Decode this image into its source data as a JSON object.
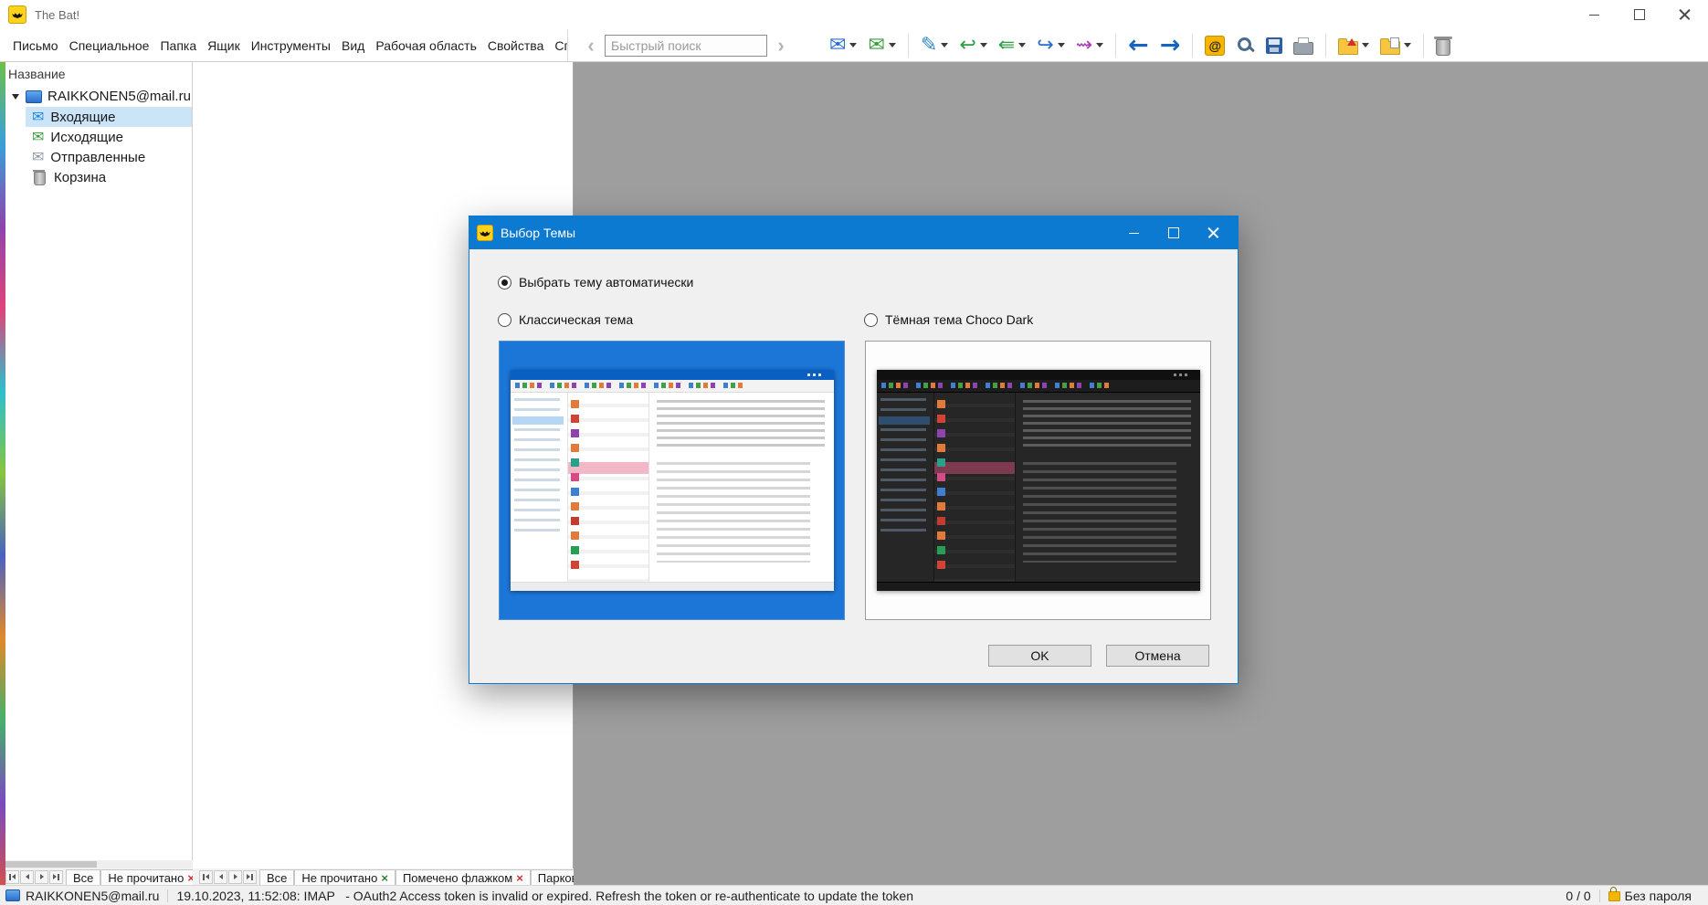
{
  "window": {
    "title": "The Bat!"
  },
  "menubar": {
    "items": [
      "Письмо",
      "Специальное",
      "Папка",
      "Ящик",
      "Инструменты",
      "Вид",
      "Рабочая область",
      "Свойства",
      "Справка"
    ]
  },
  "search": {
    "placeholder": "Быстрый поиск"
  },
  "toolbar": {
    "buttons": [
      {
        "name": "new-message",
        "glyph": "✉",
        "color": "#2a6fce",
        "dropdown": true
      },
      {
        "name": "new-message-from-template",
        "glyph": "✉",
        "color": "#3a9e3a",
        "dropdown": true
      },
      {
        "name": "edit-templates",
        "glyph": "✎",
        "color": "#2e86c1",
        "dropdown": true,
        "group_start": true
      },
      {
        "name": "reply",
        "glyph": "↩",
        "color": "#2f9e44",
        "dropdown": true
      },
      {
        "name": "reply-all",
        "glyph": "⇚",
        "color": "#2f9e44",
        "dropdown": true
      },
      {
        "name": "forward",
        "glyph": "↪",
        "color": "#2a6fce",
        "dropdown": true
      },
      {
        "name": "redirect",
        "glyph": "⇝",
        "color": "#a93db8",
        "dropdown": true
      },
      {
        "name": "previous-unread",
        "glyph": "←",
        "color": "#1565c0",
        "group_start": true
      },
      {
        "name": "next-unread",
        "glyph": "→",
        "color": "#1565c0"
      },
      {
        "name": "address-book",
        "glyph": "@",
        "css": "addressbook",
        "group_start": true
      },
      {
        "name": "search-messages",
        "css": "search"
      },
      {
        "name": "save-message",
        "css": "save"
      },
      {
        "name": "print-message",
        "css": "print"
      },
      {
        "name": "move-to-folder",
        "css": "folder folder-move",
        "dropdown": true,
        "group_start": true
      },
      {
        "name": "copy-to-folder",
        "css": "folder folder-copy",
        "dropdown": true
      },
      {
        "name": "delete-message",
        "css": "trashcan",
        "group_start": true
      }
    ]
  },
  "sidebar": {
    "header": "Название",
    "account": "RAIKKONEN5@mail.ru",
    "folders": [
      {
        "name": "inbox",
        "label": "Входящие",
        "glyph": "✉",
        "color": "#1e88e5",
        "selected": true
      },
      {
        "name": "outbox",
        "label": "Исходящие",
        "glyph": "✉",
        "color": "#3a9e3a"
      },
      {
        "name": "sent",
        "label": "Отправленные",
        "glyph": "✉",
        "color": "#8d9aa5"
      },
      {
        "name": "trash",
        "label": "Корзина",
        "css": "trash"
      }
    ]
  },
  "folder_tabs": {
    "close_glyph": "×",
    "groups": [
      {
        "tabs": [
          {
            "label": "Все"
          },
          {
            "label": "Не прочитано",
            "close_color": "#d32f2f"
          }
        ]
      },
      {
        "tabs": [
          {
            "label": "Все"
          },
          {
            "label": "Не прочитано",
            "close_color": "#2e7d32"
          },
          {
            "label": "Помечено флажком",
            "close_color": "#d32f2f"
          },
          {
            "label": "Парков"
          }
        ]
      }
    ]
  },
  "statusbar": {
    "account": "RAIKKONEN5@mail.ru",
    "message": "19.10.2023, 11:52:08: IMAP   - OAuth2 Access token is invalid or expired. Refresh the token or re-authenticate to update the token",
    "counter": "0 / 0",
    "password_mode": "Без пароля"
  },
  "dialog": {
    "title": "Выбор Темы",
    "options": {
      "auto": "Выбрать тему автоматически",
      "classic": "Классическая тема",
      "dark": "Тёмная тема Choco Dark"
    },
    "buttons": {
      "ok": "OK",
      "cancel": "Отмена"
    }
  },
  "colors": {
    "dialog_titlebar": "#0d7ad2",
    "classic_preview_bg": "#1b76d8",
    "folder_selection": "#cbe4f7",
    "reading_pane_bg": "#9e9e9e"
  }
}
